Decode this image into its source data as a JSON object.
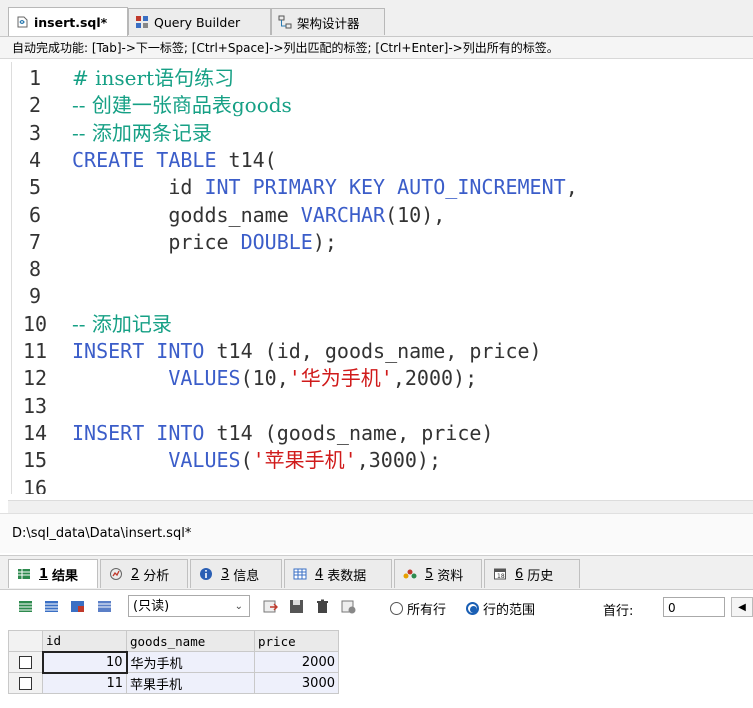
{
  "tabs": [
    {
      "label": "insert.sql*",
      "icon": "sql-file-icon",
      "active": true
    },
    {
      "label": "Query Builder",
      "icon": "query-builder-icon",
      "active": false
    },
    {
      "label": "架构设计器",
      "icon": "schema-designer-icon",
      "active": false
    }
  ],
  "hint": "自动完成功能: [Tab]->下一标签; [Ctrl+Space]->列出匹配的标签; [Ctrl+Enter]->列出所有的标签。",
  "editor": {
    "lines": [
      {
        "n": "1",
        "parts": [
          {
            "t": "# insert语句练习",
            "c": "cm"
          }
        ]
      },
      {
        "n": "2",
        "parts": [
          {
            "t": "-- 创建一张商品表goods",
            "c": "cm"
          }
        ]
      },
      {
        "n": "3",
        "parts": [
          {
            "t": "-- 添加两条记录",
            "c": "cm"
          }
        ]
      },
      {
        "n": "4",
        "parts": [
          {
            "t": "CREATE TABLE",
            "c": "kw"
          },
          {
            "t": " t14(",
            "c": "num"
          }
        ]
      },
      {
        "n": "5",
        "parts": [
          {
            "t": "        id ",
            "c": "num"
          },
          {
            "t": "INT PRIMARY KEY AUTO_INCREMENT",
            "c": "kw"
          },
          {
            "t": ",",
            "c": "num"
          }
        ]
      },
      {
        "n": "6",
        "parts": [
          {
            "t": "        godds_name ",
            "c": "num"
          },
          {
            "t": "VARCHAR",
            "c": "kw"
          },
          {
            "t": "(10),",
            "c": "num"
          }
        ]
      },
      {
        "n": "7",
        "parts": [
          {
            "t": "        price ",
            "c": "num"
          },
          {
            "t": "DOUBLE",
            "c": "kw"
          },
          {
            "t": ");",
            "c": "num"
          }
        ]
      },
      {
        "n": "8",
        "parts": []
      },
      {
        "n": "9",
        "parts": []
      },
      {
        "n": "10",
        "parts": [
          {
            "t": "-- 添加记录",
            "c": "cm"
          }
        ]
      },
      {
        "n": "11",
        "parts": [
          {
            "t": "INSERT INTO",
            "c": "kw"
          },
          {
            "t": " t14 (id, goods_name, price)",
            "c": "num"
          }
        ]
      },
      {
        "n": "12",
        "parts": [
          {
            "t": "        ",
            "c": "num"
          },
          {
            "t": "VALUES",
            "c": "kw"
          },
          {
            "t": "(10,",
            "c": "num"
          },
          {
            "t": "'华为手机'",
            "c": "str"
          },
          {
            "t": ",2000);",
            "c": "num"
          }
        ]
      },
      {
        "n": "13",
        "parts": []
      },
      {
        "n": "14",
        "parts": [
          {
            "t": "INSERT INTO",
            "c": "kw"
          },
          {
            "t": " t14 (goods_name, price)",
            "c": "num"
          }
        ]
      },
      {
        "n": "15",
        "parts": [
          {
            "t": "        ",
            "c": "num"
          },
          {
            "t": "VALUES",
            "c": "kw"
          },
          {
            "t": "(",
            "c": "num"
          },
          {
            "t": "'苹果手机'",
            "c": "str"
          },
          {
            "t": ",3000);",
            "c": "num"
          }
        ]
      },
      {
        "n": "16",
        "parts": []
      }
    ]
  },
  "status": {
    "path": "D:\\sql_data\\Data\\insert.sql*"
  },
  "result_tabs": [
    {
      "num": "1",
      "label": "结果",
      "icon": "grid-icon",
      "active": true
    },
    {
      "num": "2",
      "label": "分析",
      "icon": "analyze-icon",
      "active": false
    },
    {
      "num": "3",
      "label": "信息",
      "icon": "info-icon",
      "active": false
    },
    {
      "num": "4",
      "label": "表数据",
      "icon": "table-data-icon",
      "active": false
    },
    {
      "num": "5",
      "label": "资料",
      "icon": "profile-icon",
      "active": false
    },
    {
      "num": "6",
      "label": "历史",
      "icon": "history-icon",
      "active": false
    }
  ],
  "toolbar": {
    "readonly_select": "(只读)",
    "radio_all_rows": "所有行",
    "radio_row_range": "行的范围",
    "first_row_label": "首行:",
    "first_row_value": "0"
  },
  "grid": {
    "columns": [
      "id",
      "goods_name",
      "price"
    ],
    "rows": [
      [
        "10",
        "华为手机",
        "2000"
      ],
      [
        "11",
        "苹果手机",
        "3000"
      ]
    ]
  }
}
